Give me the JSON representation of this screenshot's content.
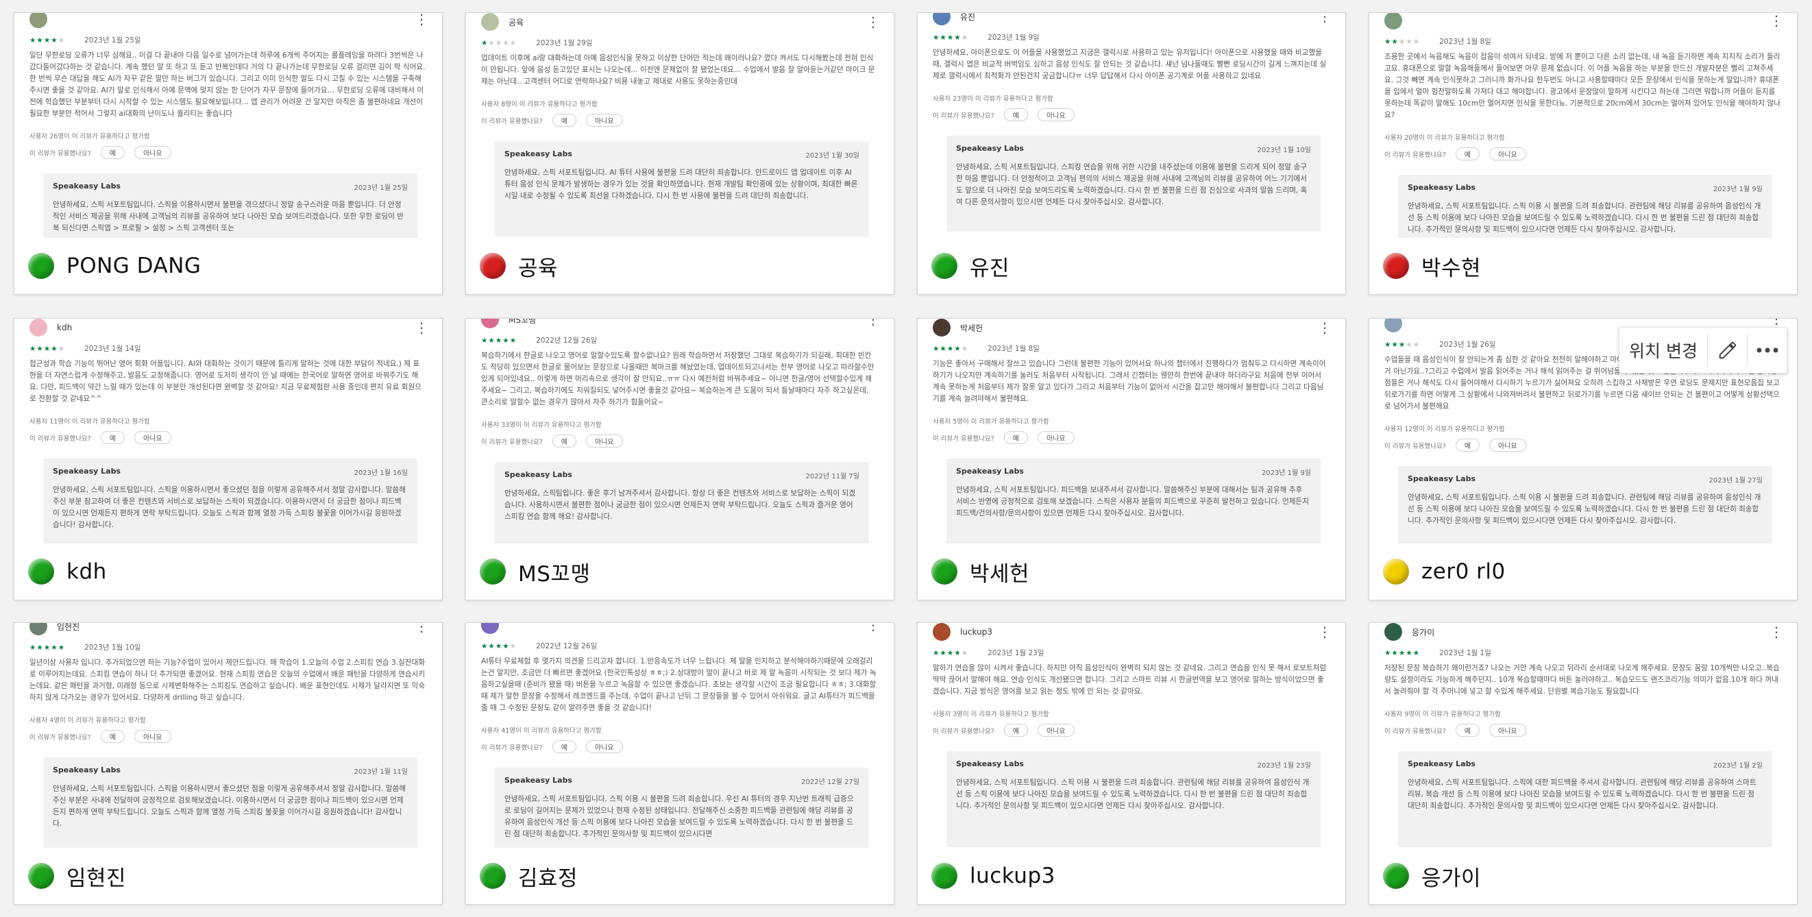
{
  "labels": {
    "helpful_q": "이 리뷰가 유용했나요?",
    "yes": "예",
    "no": "아니요",
    "reply_author": "Speakeasy Labs"
  },
  "colors": {
    "green": "#1aa31a",
    "red": "#d61f1f",
    "yellow": "#f2cf00",
    "star": "#0b8043"
  },
  "floating_toolbar": {
    "label": "위치 변경",
    "icons": [
      "pencil-icon",
      "more-horizontal-icon"
    ]
  },
  "cards": [
    {
      "footer_name": "PONG DANG",
      "status": "green",
      "reviewer": "",
      "stars": 4,
      "date": "2023년 1월 25일",
      "body": "일단 무한로딩 오류가 너무 심해요.. 이걸 다 끝내야 다음 일수로 넘어가는데 하루에 6개씩 주어지는 롤플레잉을 하려다 3번씩은 나갔다들어갔다하는 것 같습니다. 계속 했던 말 또 하고 또 듣고 반복인데다 거의 다 끝나가는데 무한로딩 오류 걸리면 김이 팍 식어요. 한 번씩 무슨 대답을 해도 AI가 자꾸 같은 말만 하는 버그가 있습니다. 그리고 이미 인식한 말도 다시 고칠 수 있는 시스템을 구축해주시면 좋을 것 같아요. AI가 말로 인식해서 아예 문맥에 맞지 않는 한 단어가 자꾸 문장에 들어가요... 무한로딩 오류에 대비해서 이전에 학습했던 부분부터 다시 시작할 수 있는 시스템도 필요해보입니다... 앱 관리가 어려운 건 알지만 아직은 좀 불편하네요 개선이 필요한 부분만 적어서 그렇지 ai대화의 난이도나 퀄리티는 좋습니다",
      "helpful_count": "사용자 26명이 이 리뷰가 유용하다고 평가함",
      "reply_date": "2023년 1월 25일",
      "reply_body": "안녕하세요, 스픽 서포트팀입니다. 스픽을 이용하시면서 불편을 겪으셨다니 정말 송구스러운 마음 뿐입니다. 더 안정적인 서비스 제공을 위해 사내에 고객님의 리뷰를 공유하여 보다 나아진 모습 보여드리겠습니다. 또한 무한 로딩이 반복 되신다면 스픽앱 > 프로필 > 설정 > 스픽 고객센터 또는"
    },
    {
      "footer_name": "공육",
      "status": "red",
      "reviewer": "공육",
      "stars": 1,
      "date": "2023년 1월 29일",
      "body": "업데이트 이후에 ai랑 대화하는데 아예 음성인식을 못하고 이상한 단어만 적는데 왜이러나요? 껐다 켜서도 다시해봤는데 전혀 인식이 안됩니다. 앞에 음성 듣고있단 표시는 나오는데... 이전엔 문제없이 잘 됐었는데요... 수업에서 발음 잘 알아듣는거같던 마이크 문제는 아닌데.. 고객센터 어디로 연락하나요? 비용 내놓고 제대로 사용도 못하는중인데",
      "helpful_count": "사용자 8명이 이 리뷰가 유용하다고 평가함",
      "reply_date": "2023년 1월 30일",
      "reply_body": "안녕하세요, 스픽 서포트팀입니다. AI 튜터 사용에 불편을 드려 대단히 죄송합니다. 안드로이드 앱 업데이트 이후 AI 튜터 음성 인식 문제가 발생하는 경우가 있는 것을 확인하였습니다. 현재 개발팀 확인중에 있는 상황이며, 최대한 빠른 시일 내로 수정될 수 있도록 최선을 다하겠습니다. 다시 한 번 사용에 불편을 드려 대단히 죄송합니다."
    },
    {
      "footer_name": "유진",
      "status": "green",
      "reviewer": "유진",
      "stars": 4,
      "date": "2023년 1월 9일",
      "body": "안녕하세요, 아이폰으로도 이 어플을 사용했었고 지금은 갤럭시로 사용하고 있는 유저입니다! 아이폰으로 사용했을 때와 비교했을 때, 갤럭시 앱은 비교적 버벅임도 심하고 음성 인식도 잘 안되는 것 같습니다. 섀넌 넘나들때도 빨빤 로딩시간이 길게 느껴지는데 실제로 갤럭시에서 최적화가 안된건지 궁금합니다ㅠ 너무 답답해서 다시 아이폰 공기계로 어플 사용하고 있네요",
      "helpful_count": "사용자 23명이 이 리뷰가 유용하다고 평가함",
      "reply_date": "2023년 1월 10일",
      "reply_body": "안녕하세요, 스픽 서포트팀입니다. 스피킹 연습을 위해 귀한 시간을 내주셨는데 이용에 불편을 드리게 되어 정말 송구한 마음 뿐입니다. 더 안정적이고 고객님 편의의 서비스 제공을 위해 사내에 고객님의 리뷰를 공유하여 어느 기기에서도 앞으로 더 나아진 모습 보여드리도록 노력하겠습니다. 다시 한 번 불편을 드린 점 진심으로 사과의 말씀 드리며, 혹여 다른 문의사항이 있으시면 언제든 다시 찾아주십시오. 감사합니다."
    },
    {
      "footer_name": "박수현",
      "status": "red",
      "reviewer": "",
      "stars": 2,
      "date": "2023년 1월 8일",
      "body": "조용한 곳에서 녹음해도 녹음이 잡음이 섞여서 되네요. 방에 저 뿐이고 다른 소리 없는데, 내 녹음 듣기하면 계속 지지직 소리가 들리고요. 휴대폰으로 말할 녹음해들께서 들어보면 아무 문제 없습니다. 이 어플 녹음을 하는 부분을 만드신 개발자분은 뻘리 고쳐주세요. 그것 빼면 계속 인식못하고 그러니까 화가나요 한두번도 아니고 사용할때마다 모든 문장에서 인식을 못하는게 말입니까? 휴대폰을 입에서 얼마 힘찬말하도록 가져다 대고 해야합니다. 광고에서 문장많이 말하게 시킨다고 하는데 그러면 뭐합니까 어플이 듣지를 못하는데 똑같이 말해도 10cm만 멀어지면 인식을 못한다뇨. 기본적으로 20cm에서 30cm는 멀어져 있어도 인식을 해야하지 않나요?",
      "helpful_count": "사용자 20명이 이 리뷰가 유용하다고 평가함",
      "reply_date": "2023년 1월 9일",
      "reply_body": "안녕하세요, 스픽 서포트팀입니다. 스픽 이용 시 불편을 드려 죄송합니다. 관련팀에 해당 리뷰를 공유하여 음성인식 개선 등 스픽 이용에 보다 나아진 모습을 보여드릴 수 있도록 노력하겠습니다. 다시 한 번 불편을 드린 점 대단히 죄송합니다. 추가적인 문의사항 및 피드백이 있으시다면 언제든 다시 찾아주십시오. 감사합니다."
    },
    {
      "footer_name": "kdh",
      "status": "green",
      "reviewer": "kdh",
      "stars": 4,
      "date": "2023년 1월 14일",
      "body": "접근성과 학습 기능이 뛰어난 영어 회화 어플입니다. AI와 대화하는 것이기 때문에 틀리게 말하는 것에 대한 부담이 적네요.) 제 표현을 더 자연스럽게 수정해주고, 발음도 교정해줍니다. 영어로 도저히 생각이 안 날 때에는 한국어로 말하면 영어로 바꿔주기도 해요. 다만, 피드백이 약간 느릴 때가 있는데 이 부분만 개선된다면 완벽할 것 같아요! 지금 무료체험판 사용 중인데 편지 유료 회원으로 전환할 것 같네요^^",
      "helpful_count": "사용자 11명이 이 리뷰가 유용하다고 평가함",
      "reply_date": "2023년 1월 16일",
      "reply_body": "안녕하세요, 스픽 서포트팀입니다. 스픽을 이용하시면서 좋으셨던 점을 이렇게 공유해주셔서 정말 감사합니다. 말씀해주신 부분 참고하여 더 좋은 컨텐츠와 서비스로 보답하는 스픽이 되겠습니다. 이용하시면서 더 궁금한 점이나 피드백이 있으시면 언제든지 편하게 연락 부탁드립니다. 오늘도 스픽과 함께 열정 가득 스피킹 불꽃을 이어가시길 응원하겠습니다! 감사합니다."
    },
    {
      "footer_name": "MS꼬맹",
      "status": "green",
      "reviewer": "MS꼬맹",
      "stars": 5,
      "date": "2022년 12월 26일",
      "body": "복습하기에서 한글로 나오고 영어로 말할수있도록 할수없나요? 원래 학습하면서 저장했던 그대로 복습하기가 되길래, 최대한 빈칸도 적당히 있으면서 한글로 물어보는 문장으로 나올때만 복마크를 해놨었는데, 업데이트되고나서는 전부 영어로 나오고 따라할수만 있게 되어있네요.. 이렇게 하면 머리속으로 생각이 잘 안되요..ㅠㅠ 다시 예전처럼 바꿔주세요~ 아니면 한글/영어 선택할수있게 해주세요~ 그리고, 복습하기에도 지워질되도 넣어주시면 좋을것 같아요~ 복습하는게 큰 도움이 되서 틈날때마다 자주 하고싶은데, 큰소리로 말할수 없는 경우가 많아서 자주 하기가 힘들어요~",
      "helpful_count": "사용자 33명이 이 리뷰가 유용하다고 평가함",
      "reply_date": "2022년 11월 7일",
      "reply_body": "안녕하세요, 스픽팀입니다. 좋은 후기 남겨주셔서 감사합니다. 항상 더 좋은 컨텐츠와 서비스로 보답하는 스픽이 되겠습니다. 사용하시면서 불편한 점이나 궁금한 점이 있으시면 언제든지 연락 부탁드립니다. 오늘도 스픽과 즐거운 영어 스피킹 연습 함께 해요! 감사합니다."
    },
    {
      "footer_name": "박세헌",
      "status": "green",
      "reviewer": "박세헌",
      "stars": 4,
      "date": "2023년 1월 8일",
      "body": "기능은 좋아서 구매해서 잘쓰고 있습니다 그런데 불편한 기능이 있어서요 하나의 챕터에서 진행하다가 멈춰두고 다시하면 계속이어하기가 나오지만 계속하기를 눌러도 처음부터 시작됩니다. 그래서 긴챕터는 웬만히 한번에 끝내야 하더라구요 처음에 전부 이어서 계속 못하는게 처음부터 제가 잘못 알고 있다가 그리고 처음부터 기능이 없어서 시간을 잡고만 해야해서 불편합니다 그리고 다음님기를 계속 늘려야해서 불편해요.",
      "helpful_count": "사용자 5명이 이 리뷰가 유용하다고 평가함",
      "reply_date": "2023년 1월 9일",
      "reply_body": "안녕하세요, 스픽 서포트팀입니다. 피드백을 보내주셔서 감사합니다. 말씀해주신 부분에 대해서는 팀과 공유해 추후 서비스 반영에 긍정적으로 검토해 보겠습니다. 스픽은 사용자 분들의 피드백으로 꾸준히 발전하고 있습니다. 언제든지 피드백/건의사항/문의사항이 있으면 언제든 다시 찾아주십시오. 감사합니다."
    },
    {
      "footer_name": "zer0 rl0",
      "status": "yellow",
      "reviewer": "",
      "stars": 3,
      "date": "2023년 1월 26일",
      "body": "수업들을 때 음성인식이 잘 안되는게 좀 심한 것 같아요 천천히 말해야하고 마이크가 인식 못하는 경우도 많아서 계속 반복하게 되는거 아닌가요..?그리고 수업에서 발음 읽어주는 거나 해석 읽어주는 걸 뛰어넘을 수 있는 것도 만들어주세요 다시하기 누르면 방식평점들은 거나 해석도 다시 들어야해서 다시하기 누르기가 싫어져요 오히려 스킵하고 사채방은 우연 로딩도 문제지만 표현모음집 보고 뒤로가기를 하면 어떻게 그 상황에서 나와져버려서 불편하고 뒤로가기를 누르면 다음 섀이브 안되는 건 불편이고 어떻게 상황선택으로 넘어가서 불편해요",
      "helpful_count": "사용자 12명이 이 리뷰가 유용하다고 평가함",
      "reply_date": "2023년 1월 27일",
      "reply_body": "안녕하세요, 스픽 서포트팀입니다. 스픽 이용 시 불편을 드려 죄송합니다. 관련팀에 해당 리뷰를 공유하여 음성인식 개선 등 스픽 이용에 보다 나아진 모습을 보여드릴 수 있도록 노력하겠습니다. 다시 한 번 불편을 드린 점 대단히 죄송합니다. 추가적인 문의사항 및 피드백이 있으시다면 언제든 다시 찾아주십시오. 감사합니다."
    },
    {
      "footer_name": "임현진",
      "status": "green",
      "reviewer": "임현진",
      "stars": 5,
      "date": "2023년 1월 10일",
      "body": "일년이상 사용자 입니다. 추가되었으면 하는 기능?수업이 있어서 제안드립니다. 매 학습이 1.오늘의 수업 2.스피킹 연습 3.실전대화로 이루어지는데요. 스피킹 연습이 하나 더 추가되면 좋겠어요. 현재 스피킹 연습은 오늘의 수업에서 배운 패턴을 다양하게 연습시키는데요. 같은 패턴을 과거형, 미래형 등으로 시제변화해주는 스피킹도 연습하고 싶습니다. 배운 표현인데도 시제가 달라지면 또 익숙하지 않게 다가오는 경우가 있어서요. 다양하게 drilling 하고 싶습니다.",
      "helpful_count": "사용자 4명이 이 리뷰가 유용하다고 평가함",
      "reply_date": "2023년 1월 11일",
      "reply_body": "안녕하세요, 스픽 서포트팀입니다. 스픽을 이용하시면서 좋으셨던 점을 이렇게 공유해주셔서 정말 감사합니다. 말씀해주신 부분은 사내에 전달하여 긍정적으로 검토해보겠습니다. 이용하시면서 더 궁금한 점이나 피드백이 있으시면 언제든지 편하게 연락 부탁드립니다. 오늘도 스픽과 함께 열정 가득 스피킹 불꽃을 이어가시길 응원하겠습니다! 감사합니다."
    },
    {
      "footer_name": "김효정",
      "status": "green",
      "reviewer": "",
      "stars": 4,
      "date": "2022년 12월 26일",
      "body": "AI튜터 무료체험 후 몇가지 의견을 드리고자 합니다. 1.반응속도가 너무 느립니다. 제 말을 인지하고 분석해야하기때문에 오래걸리는건 알지만, 조금만 더 빠르면 좋겠어요 (한국인특성상 ㅎㅎ;) 2.상대방이 말이 끝나고 바로 제 말 녹음이 시작되는 것 보다 제가 녹음하고싶을때 (준비가 됐을 때) 버튼을 누르고 녹음할 수 있으면 좋겠습니다. 초보는 생각할 시간이 조금 필요합니다 ㅎㅎ; 3.대화할 때 제가 말한 문장을 수정해서 레코멘드를 주는데, 수업이 끝나고 난뒤 그 문장들을 볼 수 있어서 아쉬워요. 글고 AI튜터가 피드백을 줄 때 그 수정된 문장도 같이 알려주면 좋을 것 같습니다!",
      "helpful_count": "사용자 41명이 이 리뷰가 유용하다고 평가함",
      "reply_date": "2022년 12월 27일",
      "reply_body": "안녕하세요, 스픽 서포트팀입니다. 스픽 이용 시 불편을 드려 죄송합니다. 우선 AI 튜터의 경우 지난번 트래픽 급증으로 로딩이 길어지는 문제가 있었으나 현재 수정된 상태입니다. 전달해주신 소중한 피드백들 관련팀에 해당 리뷰를 공유하여 음성인식 개선 등 스픽 이용에 보다 나아진 모습을 보여드릴 수 있도록 노력하겠습니다. 다시 한 번 불편을 드린 점 대단히 죄송합니다. 추가적인 문의사항 및 피드백이 있으시다면"
    },
    {
      "footer_name": "luckup3",
      "status": "green",
      "reviewer": "luckup3",
      "stars": 4,
      "date": "2023년 1월 23일",
      "body": "말하기 연습을 많이 시켜서 좋습니다. 하지만 아직 음성인식이 완벽히 되지 않는 것 같네요. 그리고 연습을 인식 못 해서 로보트처럼 딱딱 끊어서 말해야 해요. 연습 인식도 개선됐으면 합니다. 그리고 스마트 리뷰 시 한글번역을 보고 영어로 말하는 방식이었으면 좋겠습니다. 지금 방식은 영어를 보고 읽는 정도 밖에 안 되는 것 같아요.",
      "helpful_count": "사용자 3명이 이 리뷰가 유용하다고 평가함",
      "reply_date": "2023년 1월 23일",
      "reply_body": "안녕하세요, 스픽 서포트팀입니다. 스픽 이용 시 불편을 드려 죄송합니다. 관련팀에 해당 리뷰를 공유하여 음성인식 개선 등 스픽 이용에 보다 나아진 모습을 보여드릴 수 있도록 노력하겠습니다. 다시 한 번 불편을 드린 점 대단히 죄송합니다. 추가적인 문의사항 및 피드백이 있으시다면 언제든 다시 찾아주십시오. 감사합니다."
    },
    {
      "footer_name": "응가이",
      "status": "green",
      "reviewer": "응가이",
      "stars": 5,
      "date": "2023년 1월 1일",
      "body": "저장된 문장 복습하기 왜이런거죠? 나오는 거만 계속 나오고 뒤라리 순서대로 나오게 해주세요. 문장도 꽁랑 10개씩만 나오고..복습량도 설정이라도 가능하게 해주던지.. 10개 복습할때마다 버튼 눌러야하고.. 복습모드도 랜즈코리기능 의미가 없음.10개 하다 꺼내서 놀려줘야 할 걱 주머니에 넣고 할 수있게 해주세요. 단원별 복습기능도 필요합니다",
      "helpful_count": "사용자 9명이 이 리뷰가 유용하다고 평가함",
      "reply_date": "2023년 1월 2일",
      "reply_body": "안녕하세요, 스픽 서포트팀입니다. 스픽에 대한 피드백을 주셔서 감사합니다. 관련팀에 해당 리뷰를 공유하여 스마트리뷰, 복습 개선 등 스픽 이용에 보다 나아진 모습을 보여드릴 수 있도록 노력하겠습니다. 다시 한 번 불편을 드린 점 대단히 죄송합니다. 추가적인 문의사항 및 피드백이 있으시다면 언제든 다시 찾아주십시오. 감사합니다."
    }
  ]
}
